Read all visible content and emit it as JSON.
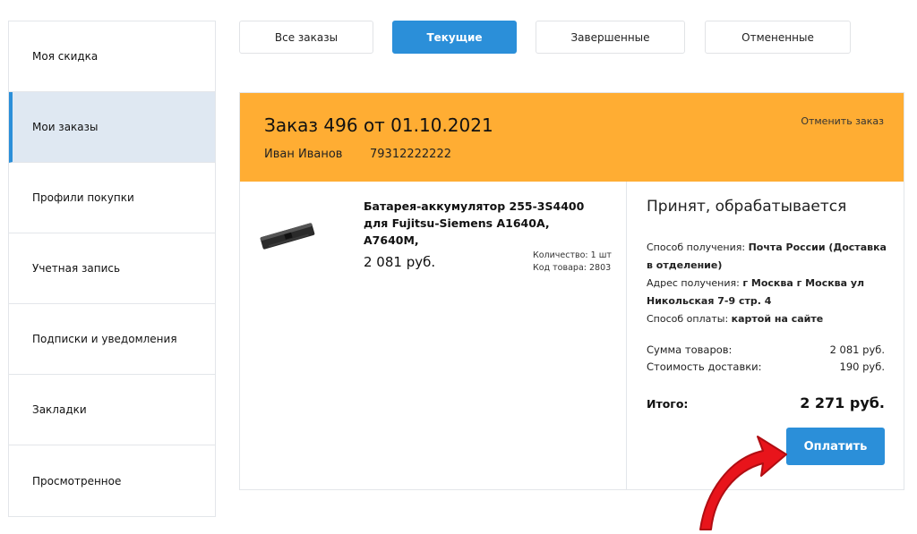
{
  "sidebar": {
    "items": [
      {
        "label": "Моя скидка"
      },
      {
        "label": "Мои заказы"
      },
      {
        "label": "Профили покупки"
      },
      {
        "label": "Учетная запись"
      },
      {
        "label": "Подписки и уведомления"
      },
      {
        "label": "Закладки"
      },
      {
        "label": "Просмотренное"
      }
    ]
  },
  "tabs": [
    {
      "label": "Все заказы"
    },
    {
      "label": "Текущие"
    },
    {
      "label": "Завершенные"
    },
    {
      "label": "Отмененные"
    }
  ],
  "order": {
    "title": "Заказ 496 от 01.10.2021",
    "customer_name": "Иван Иванов",
    "phone": "79312222222",
    "cancel_label": "Отменить заказ",
    "product": {
      "name": "Батарея-аккумулятор 255-3S4400 для Fujitsu-Siemens A1640A, A7640M,",
      "price": "2 081 руб.",
      "quantity": "Количество: 1 шт",
      "code": "Код товара: 2803"
    },
    "status": "Принят, обрабатывается",
    "delivery_label": "Способ получения: ",
    "delivery_value": "Почта России (Доставка в отделение)",
    "address_label": "Адрес получения: ",
    "address_value": "г Москва г Москва ул Никольская 7-9 стр. 4",
    "payment_label": "Способ оплаты: ",
    "payment_value": "картой на сайте",
    "goods_sum_label": "Сумма товаров:",
    "goods_sum_value": "2 081 руб.",
    "delivery_cost_label": "Стоимость доставки:",
    "delivery_cost_value": "190 руб.",
    "total_label": "Итого:",
    "total_value": "2 271 руб.",
    "pay_label": "Оплатить"
  },
  "colors": {
    "accent": "#2b8fd9",
    "order_header": "#ffad33",
    "arrow": "#e8141b"
  }
}
